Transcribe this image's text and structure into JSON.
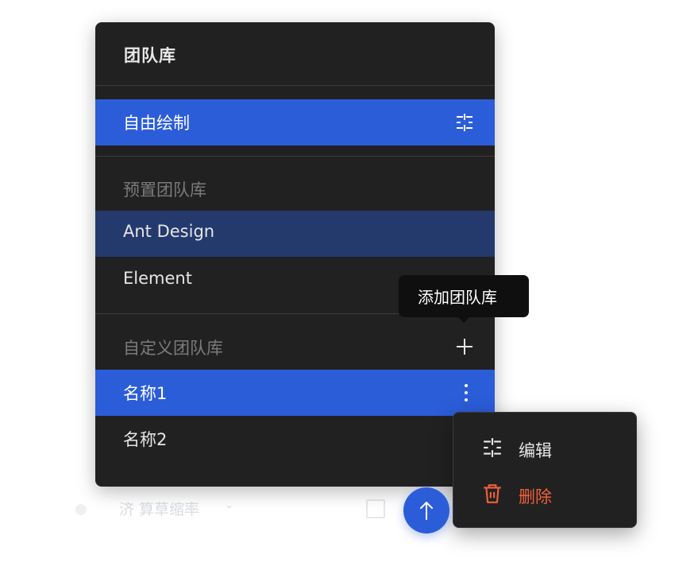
{
  "background_toolbar": {
    "text": "济 算草缩率",
    "chevron": "⌄"
  },
  "panel": {
    "title": "团队库",
    "free_draw": {
      "label": "自由绘制",
      "icon": "sliders-icon"
    },
    "preset_section": {
      "label": "预置团队库",
      "items": [
        {
          "label": "Ant Design",
          "state": "hovered"
        },
        {
          "label": "Element",
          "state": "normal"
        }
      ]
    },
    "custom_section": {
      "label": "自定义团队库",
      "add_icon": "plus-icon",
      "items": [
        {
          "label": "名称1",
          "state": "selected",
          "icon": "more-vertical-icon"
        },
        {
          "label": "名称2",
          "state": "normal"
        }
      ]
    }
  },
  "tooltip": {
    "text": "添加团队库"
  },
  "context_menu": {
    "items": [
      {
        "label": "编辑",
        "icon": "sliders-icon",
        "color": "#e6e6e6"
      },
      {
        "label": "删除",
        "icon": "trash-icon",
        "color": "#f0603a"
      }
    ]
  },
  "scroll_top_button": {
    "icon": "arrow-up-icon"
  },
  "colors": {
    "panel_bg": "#212121",
    "accent": "#2c5dd9",
    "hover": "#24396c",
    "danger": "#f0603a",
    "tooltip_bg": "#0f0f0f"
  }
}
